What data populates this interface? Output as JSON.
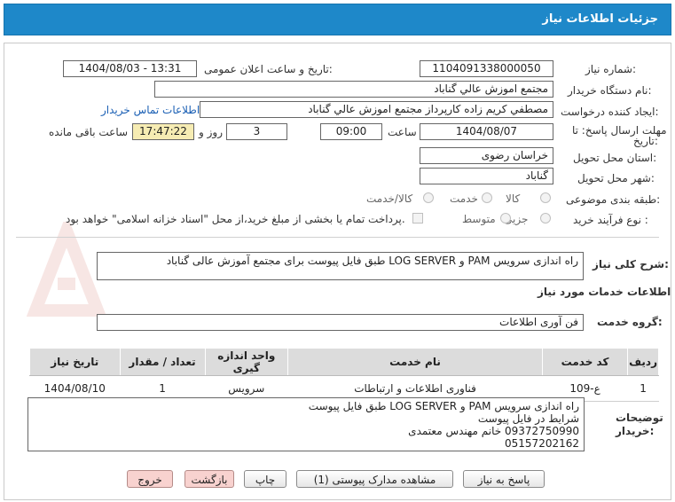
{
  "title": "جزئیات اطلاعات نیاز",
  "fields": {
    "need_number_label": "شماره نیاز:",
    "need_number": "1104091338000050",
    "announce_label": "تاریخ و ساعت اعلان عمومی:",
    "announce_value": "1404/08/03 - 13:31",
    "buyer_org_label": "نام دستگاه خریدار:",
    "buyer_org": "مجتمع اموزش عالي گناباد",
    "requester_label": "ایجاد کننده درخواست:",
    "requester": "مصطفي کريم زاده کارپرداز مجتمع اموزش عالي گناباد",
    "contact_link": "اطلاعات تماس خریدار",
    "deadline_label_1": "مهلت ارسال پاسخ: تا",
    "deadline_label_2": "تاریخ:",
    "deadline_date": "1404/08/07",
    "time_label": "ساعت",
    "deadline_time": "09:00",
    "days": "3",
    "days_label": "روز و",
    "remaining_time": "17:47:22",
    "remaining_label": "ساعت باقی مانده",
    "province_label": "استان محل تحویل:",
    "province": "خراسان رضوی",
    "city_label": "شهر محل تحویل:",
    "city": "گناباد",
    "category_label": "طبقه بندی موضوعی:",
    "category_options": [
      "کالا",
      "خدمت",
      "کالا/خدمت"
    ],
    "process_label": "نوع فرآیند خرید :",
    "process_options": [
      "جزیی",
      "متوسط"
    ],
    "payment_note": "پرداخت تمام یا بخشی از مبلغ خرید،از محل \"اسناد خزانه اسلامی\" خواهد بود."
  },
  "summary": {
    "label": "شرح کلی نیاز:",
    "text": "راه اندازی سرویس PAM و LOG SERVER طبق فایل پیوست  برای مجتمع آموزش عالی گناباد"
  },
  "services_header": "اطلاعات خدمات مورد نیاز",
  "service_group": {
    "label": "گروه خدمت:",
    "value": "فن آوری اطلاعات"
  },
  "table": {
    "headers": [
      "ردیف",
      "کد خدمت",
      "نام خدمت",
      "واحد اندازه گیری",
      "تعداد / مقدار",
      "تاریخ نیاز"
    ],
    "rows": [
      [
        "1",
        "ع-109",
        "فناوری اطلاعات و ارتباطات",
        "سرویس",
        "1",
        "1404/08/10"
      ]
    ]
  },
  "notes": {
    "label_1": "توضیحات",
    "label_2": "خریدار:",
    "lines": [
      "راه اندازی سرویس PAM و LOG SERVER طبق فایل پیوست",
      "شرایط در فایل پیوست",
      "09372750990 خانم مهندس معتمدی",
      "05157202162"
    ]
  },
  "buttons": {
    "reply": "پاسخ به نیاز",
    "docs": "مشاهده مدارک پیوستی (1)",
    "print": "چاپ",
    "back": "بازگشت",
    "exit": "خروج"
  },
  "colors": {
    "title_bar": "#1e88c9",
    "highlight": "#f6ecb3",
    "pink_button": "#f8d2cf"
  }
}
